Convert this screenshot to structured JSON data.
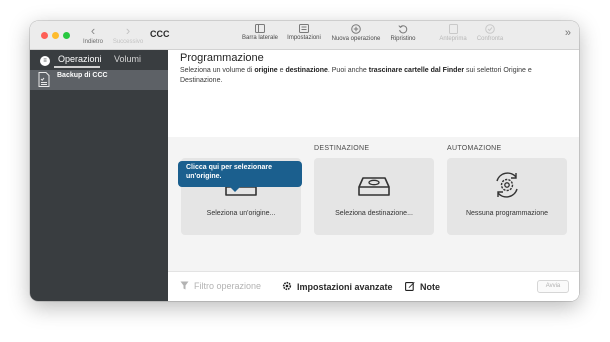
{
  "toolbar": {
    "back_label": "Indietro",
    "forward_label": "Successivo",
    "app_title": "CCC",
    "items": [
      {
        "label": "Barra laterale",
        "icon": "sidebar-icon",
        "enabled": true
      },
      {
        "label": "Impostazioni",
        "icon": "settings-panel-icon",
        "enabled": true
      },
      {
        "label": "Nuova operazione",
        "icon": "plus-circle-icon",
        "enabled": true
      },
      {
        "label": "Ripristino",
        "icon": "restore-icon",
        "enabled": true
      },
      {
        "label": "Anteprima",
        "icon": "preview-icon",
        "enabled": false
      },
      {
        "label": "Confronta",
        "icon": "compare-icon",
        "enabled": false
      }
    ],
    "more_glyph": "»"
  },
  "sidebar": {
    "tabs": [
      "Operazioni",
      "Volumi"
    ],
    "active_tab": "Operazioni",
    "items": [
      {
        "label": "Backup di CCC",
        "selected": true
      }
    ]
  },
  "main": {
    "title": "Programmazione",
    "description": {
      "p1": "Seleziona un volume di ",
      "b1": "origine",
      "p2": " e ",
      "b2": "destinazione",
      "p3": ". Puoi anche ",
      "b3": "trascinare cartelle dal Finder",
      "p4": " sui selettori Origine e Destinazione."
    },
    "columns": [
      {
        "header": "",
        "text": "Seleziona un'origine...",
        "icon": "drive-icon"
      },
      {
        "header": "DESTINAZIONE",
        "text": "Seleziona destinazione...",
        "icon": "drive-icon"
      },
      {
        "header": "AUTOMAZIONE",
        "text": "Nessuna programmazione",
        "icon": "gear-sync-icon"
      }
    ],
    "tooltip": "Clicca qui per selezionare un'origine."
  },
  "bottombar": {
    "filter_label": "Filtro operazione",
    "advanced_label": "Impostazioni avanzate",
    "notes_label": "Note",
    "run_label": "Avvia"
  },
  "colors": {
    "sidebar_bg": "#393d40",
    "sidebar_selected": "#5d6166",
    "tooltip_bg": "#1b5f8e",
    "close": "#fe5f57",
    "minimize": "#febc2e",
    "zoom": "#28c840"
  }
}
